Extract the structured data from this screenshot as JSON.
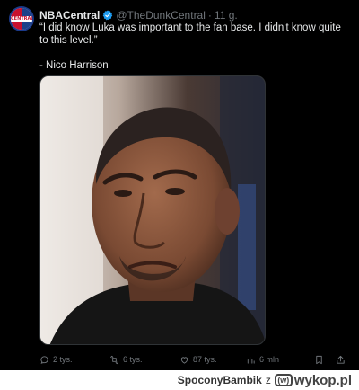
{
  "tweet": {
    "author_name": "NBACentral",
    "author_handle": "@TheDunkCentral",
    "separator": "·",
    "timestamp": "11 g.",
    "avatar_text": "CENTRAL",
    "text": "“I did know Luka was important to the fan base. I didn't know quite to this level.”",
    "attribution": "- Nico Harrison",
    "verified_color": "#1d9bf0"
  },
  "actions": {
    "replies": "2 tys.",
    "retweets": "6 tys.",
    "likes": "87 tys.",
    "views": "6 mln"
  },
  "footer": {
    "username": "SpoconyBambik",
    "connector": "z",
    "site_logo_text": "wykop.pl",
    "site_logo_mark": "(w)"
  }
}
